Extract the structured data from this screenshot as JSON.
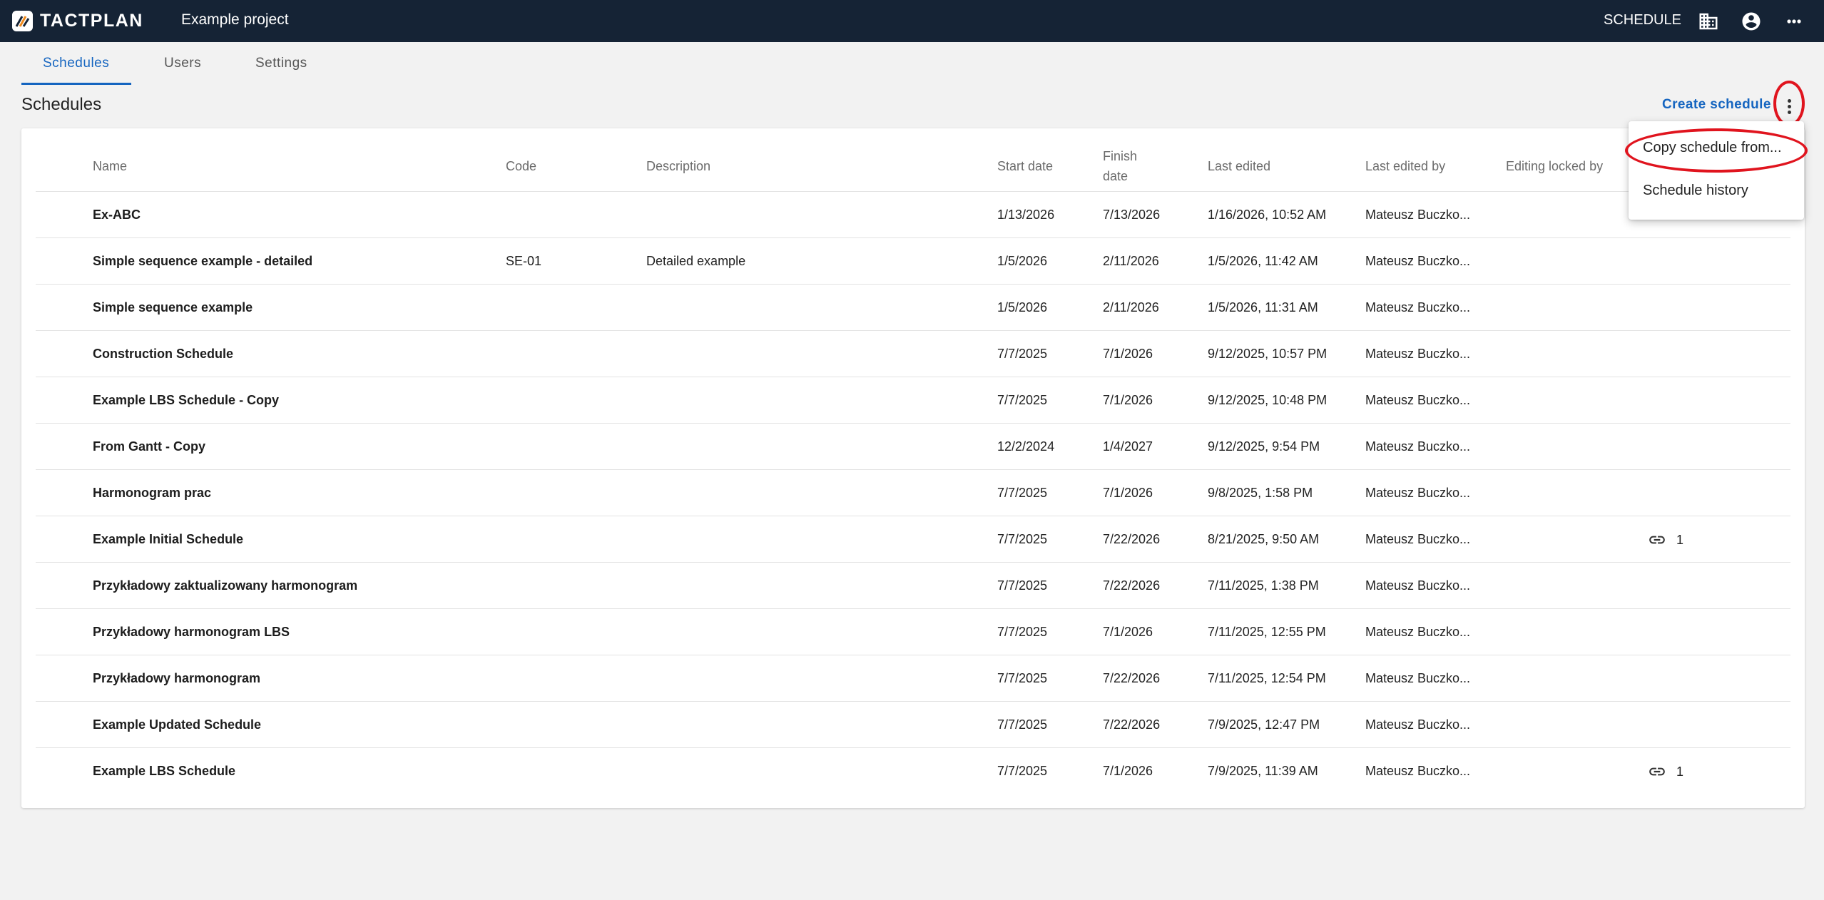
{
  "topbar": {
    "logo_text": "TACTPLAN",
    "project_title": "Example project",
    "schedule_label": "SCHEDULE"
  },
  "tabs": [
    {
      "label": "Schedules",
      "active": true
    },
    {
      "label": "Users",
      "active": false
    },
    {
      "label": "Settings",
      "active": false
    }
  ],
  "section_title": "Schedules",
  "create_label": "Create schedule",
  "columns": {
    "name": "Name",
    "code": "Code",
    "description": "Description",
    "start": "Start date",
    "finish_1": "Finish",
    "finish_2": "date",
    "last_edited": "Last edited",
    "last_edited_by": "Last edited by",
    "locked_by": "Editing locked by"
  },
  "rows": [
    {
      "name": "Ex-ABC",
      "code": "",
      "description": "",
      "start": "1/13/2026",
      "finish": "7/13/2026",
      "edited": "1/16/2026, 10:52 AM",
      "by": "Mateusz Buczko...",
      "links": ""
    },
    {
      "name": "Simple sequence example - detailed",
      "code": "SE-01",
      "description": "Detailed example",
      "start": "1/5/2026",
      "finish": "2/11/2026",
      "edited": "1/5/2026, 11:42 AM",
      "by": "Mateusz Buczko...",
      "links": ""
    },
    {
      "name": "Simple sequence example",
      "code": "",
      "description": "",
      "start": "1/5/2026",
      "finish": "2/11/2026",
      "edited": "1/5/2026, 11:31 AM",
      "by": "Mateusz Buczko...",
      "links": ""
    },
    {
      "name": "Construction Schedule",
      "code": "",
      "description": "",
      "start": "7/7/2025",
      "finish": "7/1/2026",
      "edited": "9/12/2025, 10:57 PM",
      "by": "Mateusz Buczko...",
      "links": ""
    },
    {
      "name": "Example LBS Schedule - Copy",
      "code": "",
      "description": "",
      "start": "7/7/2025",
      "finish": "7/1/2026",
      "edited": "9/12/2025, 10:48 PM",
      "by": "Mateusz Buczko...",
      "links": ""
    },
    {
      "name": "From Gantt - Copy",
      "code": "",
      "description": "",
      "start": "12/2/2024",
      "finish": "1/4/2027",
      "edited": "9/12/2025, 9:54 PM",
      "by": "Mateusz Buczko...",
      "links": ""
    },
    {
      "name": "Harmonogram prac",
      "code": "",
      "description": "",
      "start": "7/7/2025",
      "finish": "7/1/2026",
      "edited": "9/8/2025, 1:58 PM",
      "by": "Mateusz Buczko...",
      "links": ""
    },
    {
      "name": "Example Initial Schedule",
      "code": "",
      "description": "",
      "start": "7/7/2025",
      "finish": "7/22/2026",
      "edited": "8/21/2025, 9:50 AM",
      "by": "Mateusz Buczko...",
      "links": "1"
    },
    {
      "name": "Przykładowy zaktualizowany harmonogram",
      "code": "",
      "description": "",
      "start": "7/7/2025",
      "finish": "7/22/2026",
      "edited": "7/11/2025, 1:38 PM",
      "by": "Mateusz Buczko...",
      "links": ""
    },
    {
      "name": "Przykładowy harmonogram LBS",
      "code": "",
      "description": "",
      "start": "7/7/2025",
      "finish": "7/1/2026",
      "edited": "7/11/2025, 12:55 PM",
      "by": "Mateusz Buczko...",
      "links": ""
    },
    {
      "name": "Przykładowy harmonogram",
      "code": "",
      "description": "",
      "start": "7/7/2025",
      "finish": "7/22/2026",
      "edited": "7/11/2025, 12:54 PM",
      "by": "Mateusz Buczko...",
      "links": ""
    },
    {
      "name": "Example Updated Schedule",
      "code": "",
      "description": "",
      "start": "7/7/2025",
      "finish": "7/22/2026",
      "edited": "7/9/2025, 12:47 PM",
      "by": "Mateusz Buczko...",
      "links": ""
    },
    {
      "name": "Example LBS Schedule",
      "code": "",
      "description": "",
      "start": "7/7/2025",
      "finish": "7/1/2026",
      "edited": "7/9/2025, 11:39 AM",
      "by": "Mateusz Buczko...",
      "links": "1"
    }
  ],
  "menu": {
    "items": [
      "Copy schedule from...",
      "Schedule history"
    ]
  },
  "icons": {
    "logo": "tactplan-logo-icon",
    "building": "building-icon",
    "account": "account-circle-icon",
    "more": "more-horizontal-icon",
    "kebab": "more-vertical-icon",
    "link": "link-icon"
  },
  "colors": {
    "topbar": "#152335",
    "accent": "#1565c0",
    "highlight": "#e0141e"
  }
}
